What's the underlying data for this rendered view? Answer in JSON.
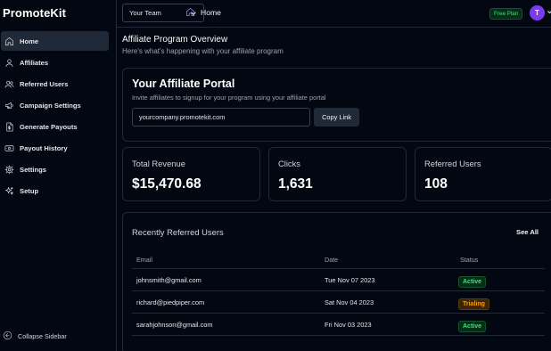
{
  "app": {
    "logo": "PromoteKit"
  },
  "sidebar": {
    "items": [
      {
        "label": "Home",
        "icon": "home-icon",
        "active": true
      },
      {
        "label": "Affiliates",
        "icon": "user-icon"
      },
      {
        "label": "Referred Users",
        "icon": "users-icon"
      },
      {
        "label": "Campaign Settings",
        "icon": "megaphone-icon"
      },
      {
        "label": "Generate Payouts",
        "icon": "dollar-file-icon"
      },
      {
        "label": "Payout History",
        "icon": "banknote-icon"
      },
      {
        "label": "Settings",
        "icon": "gear-icon"
      },
      {
        "label": "Setup",
        "icon": "sparkles-icon"
      }
    ],
    "collapse_label": "Collapse Sidebar"
  },
  "topbar": {
    "team_select": "Your Team",
    "breadcrumb": "Home",
    "plan_badge": "Free Plan",
    "avatar_initial": "T"
  },
  "main": {
    "title": "Affiliate Program Overview",
    "subtitle": "Here's what's happening with your affiliate program",
    "portal": {
      "title": "Your Affiliate Portal",
      "description": "Invite affiliates to signup for your program using your affiliate portal",
      "url_value": "yourcompany.promotekit.com",
      "copy_label": "Copy Link"
    },
    "stats": [
      {
        "label": "Total Revenue",
        "value": "$15,470.68"
      },
      {
        "label": "Clicks",
        "value": "1,631"
      },
      {
        "label": "Referred Users",
        "value": "108"
      }
    ],
    "recent": {
      "title": "Recently Referred Users",
      "see_all": "See All",
      "columns": [
        "Email",
        "Date",
        "Status"
      ],
      "rows": [
        {
          "email": "johnsmith@gmail.com",
          "date": "Tue Nov 07 2023",
          "status": "Active"
        },
        {
          "email": "richard@piedpiper.com",
          "date": "Sat Nov 04 2023",
          "status": "Trialing"
        },
        {
          "email": "sarahjohnson@gmail.com",
          "date": "Fri Nov 03 2023",
          "status": "Active"
        }
      ]
    }
  },
  "colors": {
    "background": "#030712",
    "border": "#1f2937",
    "accent": "#7c3aed",
    "active_status": "#4ade80",
    "trialing_status": "#f59e0b"
  }
}
